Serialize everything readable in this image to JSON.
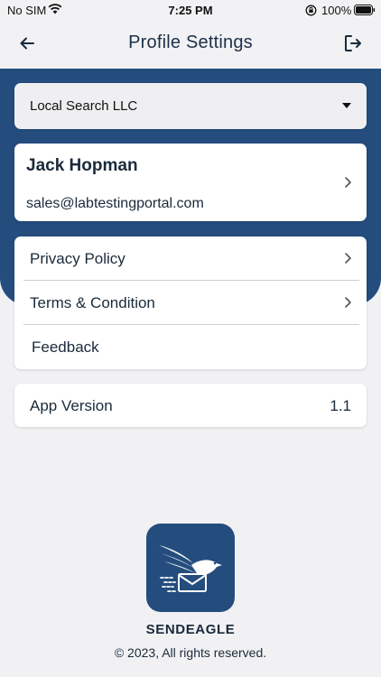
{
  "status_bar": {
    "carrier": "No SIM",
    "time": "7:25 PM",
    "battery": "100%"
  },
  "header": {
    "title": "Profile Settings",
    "back_icon": "arrow-left-icon",
    "logout_icon": "logout-icon"
  },
  "company_select": {
    "selected": "Local Search LLC"
  },
  "profile": {
    "name": "Jack Hopman",
    "email": "sales@labtestingportal.com"
  },
  "menu": {
    "items": [
      {
        "label": "Privacy Policy"
      },
      {
        "label": "Terms & Condition"
      },
      {
        "label": "Feedback"
      }
    ]
  },
  "app_version": {
    "label": "App Version",
    "value": "1.1"
  },
  "footer": {
    "app_name": "SENDEAGLE",
    "copyright": "© 2023, All rights reserved."
  },
  "colors": {
    "primary": "#244d7e",
    "background": "#f1f1f3",
    "text": "#1a2a3a"
  }
}
